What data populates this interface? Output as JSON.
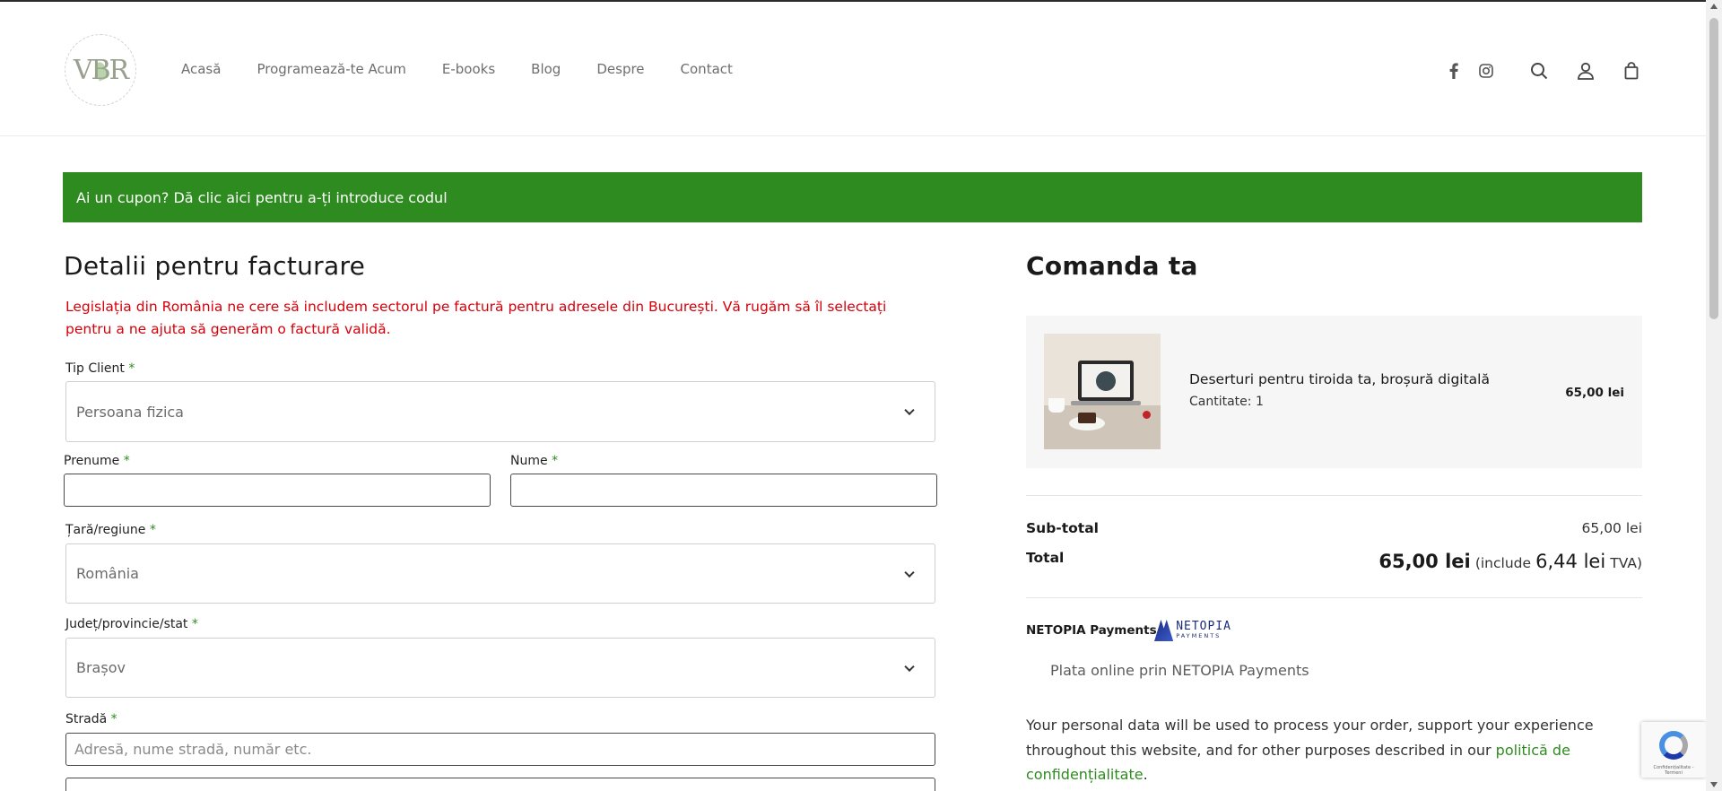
{
  "header": {
    "logo_text": "VBR",
    "nav": [
      "Acasă",
      "Programează-te Acum",
      "E-books",
      "Blog",
      "Despre",
      "Contact"
    ],
    "icons": [
      "facebook-icon",
      "instagram-icon",
      "search-icon",
      "account-icon",
      "cart-icon"
    ]
  },
  "coupon": {
    "text": "Ai un cupon? Dă clic aici pentru a-ți introduce codul",
    "color": "#2e8b1f"
  },
  "billing": {
    "title": "Detalii pentru facturare",
    "notice": "Legislația din România ne cere să includem sectorul pe factură pentru adresele din București. Vă rugăm să îl selectați pentru a ne ajuta să generăm o factură validă.",
    "fields": {
      "client_type": {
        "label": "Tip Client",
        "required": "*",
        "value": "Persoana fizica"
      },
      "first_name": {
        "label": "Prenume",
        "required": "*",
        "value": ""
      },
      "last_name": {
        "label": "Nume",
        "required": "*",
        "value": ""
      },
      "country": {
        "label": "Țară/regiune",
        "required": "*",
        "value": "România"
      },
      "county": {
        "label": "Județ/provincie/stat",
        "required": "*",
        "value": "Brașov"
      },
      "street": {
        "label": "Stradă",
        "required": "*",
        "placeholder": "Adresă, nume stradă, număr etc."
      }
    }
  },
  "order": {
    "title": "Comanda ta",
    "item": {
      "name": "Deserturi pentru tiroida ta, broșură digitală",
      "qty": "Cantitate: 1",
      "price": "65,00 lei"
    },
    "subtotal_label": "Sub-total",
    "subtotal_value": "65,00 lei",
    "total_label": "Total",
    "total_value": "65,00 lei",
    "total_vat_prefix": "(include",
    "total_vat_amount": "6,44 lei",
    "total_vat_suffix": "TVA)"
  },
  "payment": {
    "method_label": "NETOPIA Payments",
    "logo_line1": "NETOPIA",
    "logo_line2": "PAYMENTS",
    "description": "Plata online prin NETOPIA Payments",
    "privacy_text": "Your personal data will be used to process your order, support your experience throughout this website, and for other purposes described in our",
    "privacy_link": "politică de confidențialitate",
    "privacy_end": "."
  },
  "recaptcha": {
    "footer": "Confidențialitate - Termeni"
  }
}
